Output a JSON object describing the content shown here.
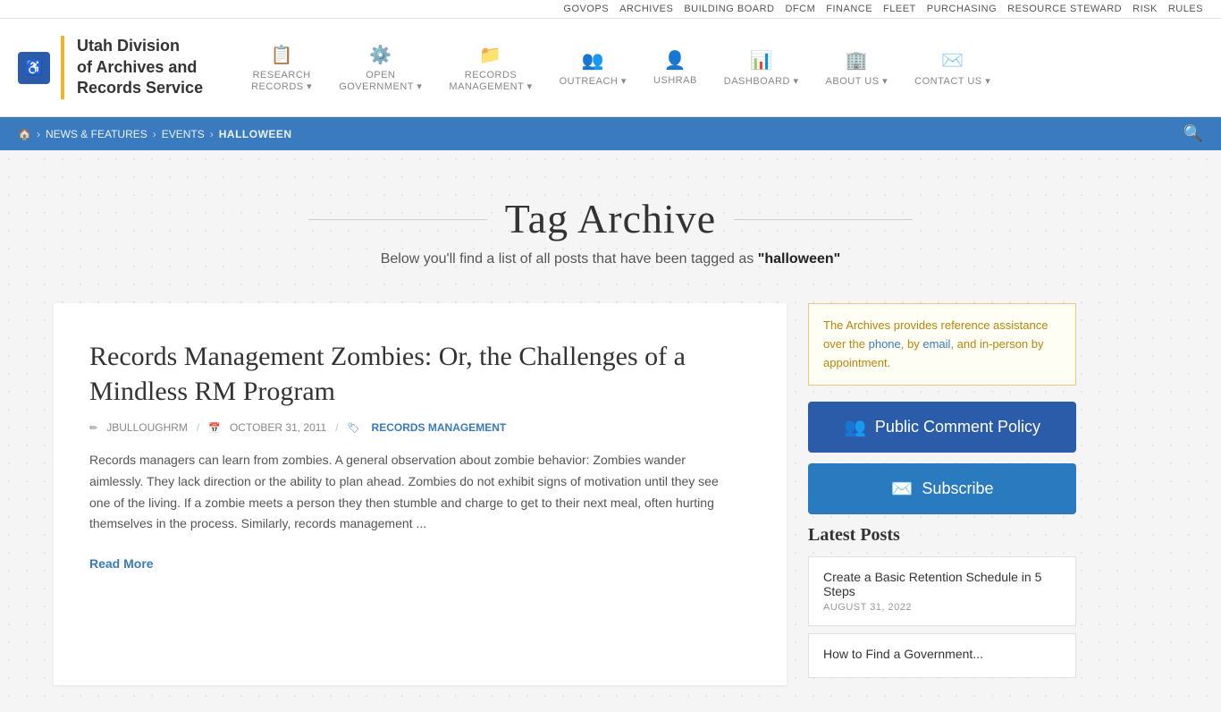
{
  "topnav": {
    "items": [
      "GOVOPS",
      "ARCHIVES",
      "BUILDING BOARD",
      "DFCM",
      "FINANCE",
      "FLEET",
      "PURCHASING",
      "RESOURCE STEWARD",
      "RISK",
      "RULES"
    ]
  },
  "header": {
    "logo": {
      "line1": "Utah Division",
      "line2": "of Archives and",
      "line3": "Records Service"
    },
    "accessibility_label": "♿",
    "nav": [
      {
        "icon": "📋",
        "label": "RESEARCH\nRECORDS ▾",
        "id": "research-records"
      },
      {
        "icon": "⚙️",
        "label": "OPEN\nGOVERNMENT ▾",
        "id": "open-government"
      },
      {
        "icon": "📁",
        "label": "RECORDS\nMANAGEMENT ▾",
        "id": "records-management"
      },
      {
        "icon": "👥",
        "label": "OUTREACH ▾",
        "id": "outreach"
      },
      {
        "icon": "👤",
        "label": "USHRAB",
        "id": "ushrab"
      },
      {
        "icon": "📊",
        "label": "DASHBOARD ▾",
        "id": "dashboard"
      },
      {
        "icon": "🏢",
        "label": "ABOUT US ▾",
        "id": "about-us"
      },
      {
        "icon": "✉️",
        "label": "CONTACT US ▾",
        "id": "contact-us"
      }
    ]
  },
  "breadcrumb": {
    "home_icon": "🏠",
    "items": [
      "NEWS & FEATURES",
      "EVENTS",
      "HALLOWEEN"
    ]
  },
  "page": {
    "title": "Tag Archive",
    "subtitle_before": "Below you'll find a list of all posts that have been tagged as",
    "subtitle_tag": "\"halloween\""
  },
  "article": {
    "title": "Records Management Zombies: Or, the Challenges of a Mindless RM Program",
    "meta": {
      "author_icon": "✏",
      "author": "JBULLOUGHRM",
      "date_icon": "📅",
      "date": "OCTOBER 31, 2011",
      "category_icon": "🏷",
      "category": "RECORDS MANAGEMENT"
    },
    "body": "Records managers can learn from zombies. A general observation about zombie behavior: Zombies wander aimlessly. They lack direction or the ability to plan ahead. Zombies do not exhibit signs of motivation until they see one of the living. If a zombie meets a person they then stumble and charge to get to their next meal, often hurting themselves in the process. Similarly, records management ...",
    "read_more": "Read More"
  },
  "sidebar": {
    "info_text_before": "The Archives provides reference assistance over the",
    "info_phone": "phone",
    "info_mid": ", by",
    "info_email": "email",
    "info_after": ", and in-person by appointment.",
    "public_comment_btn": "Public Comment Policy",
    "subscribe_btn": "Subscribe",
    "latest_posts_title": "Latest Posts",
    "latest_posts": [
      {
        "title": "Create a Basic Retention Schedule in 5 Steps",
        "date": "AUGUST 31, 2022"
      },
      {
        "title": "How to Find a Government...",
        "date": ""
      }
    ]
  }
}
